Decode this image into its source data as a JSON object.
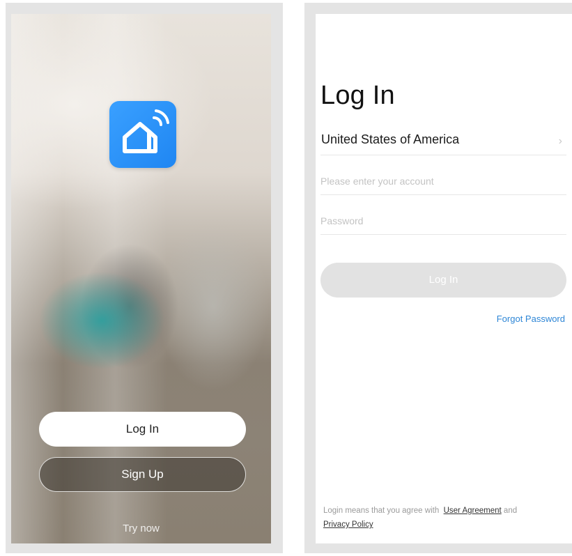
{
  "welcome": {
    "app_icon": "smart-home-wifi-icon",
    "login_label": "Log In",
    "signup_label": "Sign Up",
    "try_now_label": "Try now"
  },
  "login": {
    "title": "Log In",
    "country": "United States of America",
    "chevron": "›",
    "account_placeholder": "Please enter your account",
    "password_placeholder": "Password",
    "submit_label": "Log In",
    "forgot_password": "Forgot Password",
    "agreement_prefix": "Login means that you agree with",
    "user_agreement": "User Agreement",
    "agreement_and": "and",
    "privacy_policy": "Privacy Policy"
  },
  "colors": {
    "accent_blue": "#1f86f2",
    "link_blue": "#2e86d6",
    "disabled_button": "#e2e2e2"
  }
}
